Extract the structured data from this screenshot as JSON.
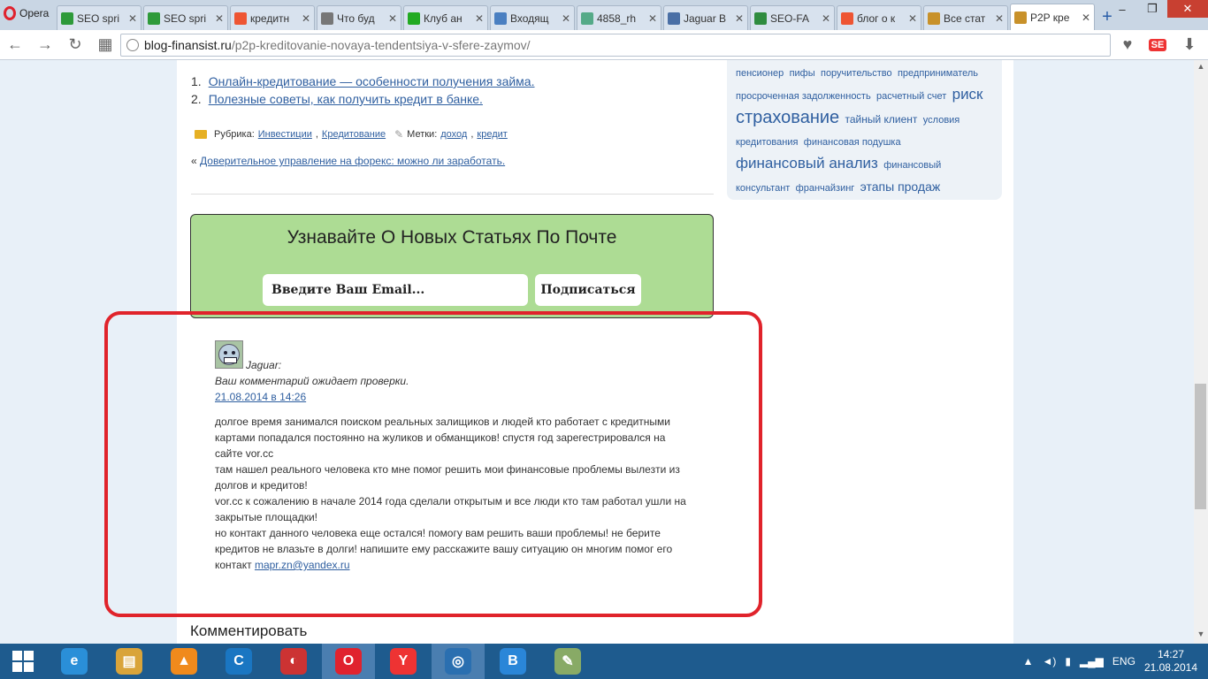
{
  "browser": {
    "menu_label": "Opera",
    "tabs": [
      {
        "title": "SEO spri",
        "icon": "dollar-icon",
        "color": "#2e9a3a"
      },
      {
        "title": "SEO spri",
        "icon": "dollar-icon",
        "color": "#2e9a3a"
      },
      {
        "title": "кредитн",
        "icon": "yandex-icon",
        "color": "#e53"
      },
      {
        "title": "Что буд",
        "icon": "page-icon",
        "color": "#777"
      },
      {
        "title": "Клуб ан",
        "icon": "club-icon",
        "color": "#2a2"
      },
      {
        "title": "Входящ",
        "icon": "mail-icon",
        "color": "#4a7fc1"
      },
      {
        "title": "4858_rh",
        "icon": "image-icon",
        "color": "#5a8"
      },
      {
        "title": "Jaguar B",
        "icon": "vk-icon",
        "color": "#4a6fa5"
      },
      {
        "title": "SEO-FA",
        "icon": "sf-icon",
        "color": "#2f8c3f"
      },
      {
        "title": "блог о к",
        "icon": "yandex-icon",
        "color": "#e53"
      },
      {
        "title": "Все стат",
        "icon": "percent-icon",
        "color": "#c8912a"
      },
      {
        "title": "P2P кре",
        "icon": "percent-icon",
        "color": "#c8912a"
      }
    ],
    "window_controls": {
      "minimize": "–",
      "maximize": "❐",
      "close": "✕"
    },
    "url_host": "blog-finansist.ru",
    "url_path": "/p2p-kreditovanie-novaya-tendentsiya-v-sfere-zaymov/"
  },
  "sidebar": {
    "tags": [
      {
        "text": "пенсионер",
        "size": 11
      },
      {
        "text": "пифы",
        "size": 11
      },
      {
        "text": "поручительство",
        "size": 11
      },
      {
        "text": "предприниматель",
        "size": 11
      },
      {
        "text": "просроченная задолженность",
        "size": 11
      },
      {
        "text": "расчетный счет",
        "size": 11
      },
      {
        "text": "риск",
        "size": 17
      },
      {
        "text": "страхование",
        "size": 20
      },
      {
        "text": "тайный клиент",
        "size": 12
      },
      {
        "text": "условия кредитования",
        "size": 11
      },
      {
        "text": "финансовая подушка",
        "size": 11
      },
      {
        "text": "финансовый анализ",
        "size": 17
      },
      {
        "text": "финансовый консультант",
        "size": 11
      },
      {
        "text": "франчайзинг",
        "size": 11
      },
      {
        "text": "этапы продаж",
        "size": 14
      }
    ]
  },
  "article": {
    "related": [
      {
        "num": "1.",
        "text": "Онлайн-кредитование — особенности получения займа."
      },
      {
        "num": "2.",
        "text": "Полезные советы, как получить кредит в банке."
      }
    ],
    "rubric_label": "Рубрика:",
    "rubrics": [
      "Инвестиции",
      "Кредитование"
    ],
    "tags_label": "Метки:",
    "tags": [
      "доход",
      "кредит"
    ],
    "prev_arrow": "«",
    "prev_link": "Доверительное управление на форекс: можно ли заработать."
  },
  "subscribe": {
    "title": "Узнавайте О Новых Статьях По Почте",
    "email_placeholder": "Введите Ваш Email...",
    "button": "Подписаться",
    "bg_color": "#addc94"
  },
  "comment": {
    "author": "Jaguar:",
    "awaiting": "Ваш комментарий ожидает проверки.",
    "date": "21.08.2014 в 14:26",
    "paragraphs": [
      "долгое время занимался поиском реальных залищиков и людей кто работает с кредитными картами попадался постоянно на жуликов и обманщиков! спустя год зарегестрировался на сайте vor.cc",
      "там нашел реального человека кто мне помог решить мои финансовые проблемы вылезти из долгов и кредитов!",
      "vor.cc к сожалению в начале 2014 года сделали открытым и все люди кто там работал ушли на закрытые площадки!",
      "но контакт данного человека еще остался! помогу вам решить ваши проблемы! не берите кредитов не влазьте в долги! напишите ему расскажите вашу ситуацию он многим помог его контакт"
    ],
    "email": "mapr.zn@yandex.ru",
    "highlight_color": "#e0232b"
  },
  "comment_form": {
    "heading": "Комментировать"
  },
  "taskbar": {
    "apps": [
      {
        "name": "ie-icon",
        "glyph": "e",
        "color": "#2a8fd8"
      },
      {
        "name": "explorer-icon",
        "glyph": "▤",
        "color": "#d9a43a"
      },
      {
        "name": "avast-icon",
        "glyph": "▲",
        "color": "#f08a1c"
      },
      {
        "name": "clipgrab-icon",
        "glyph": "C",
        "color": "#1a76c2"
      },
      {
        "name": "colorful-app-icon",
        "glyph": "◐",
        "color": "#c33"
      },
      {
        "name": "opera-taskbar-icon",
        "glyph": "O",
        "color": "#e0222e"
      },
      {
        "name": "yandex-browser-icon",
        "glyph": "Y",
        "color": "#e33"
      },
      {
        "name": "media-icon",
        "glyph": "◎",
        "color": "#2a6fb0"
      },
      {
        "name": "vk-taskbar-icon",
        "glyph": "B",
        "color": "#2a86d8"
      },
      {
        "name": "paint-icon",
        "glyph": "✎",
        "color": "#8a6"
      }
    ],
    "language": "ENG",
    "time": "14:27",
    "date": "21.08.2014"
  }
}
